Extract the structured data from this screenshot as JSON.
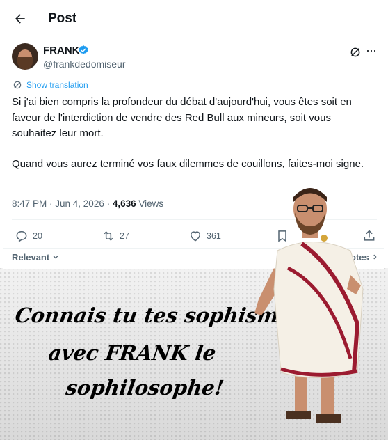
{
  "header": {
    "title": "Post"
  },
  "post": {
    "author_name": "FRANK",
    "author_handle": "@frankdedomiseur",
    "show_translation": "Show translation",
    "paragraphs": [
      "Si j'ai bien compris la profondeur du débat d'aujourd'hui, vous êtes soit en faveur de l'interdiction de vendre des Red Bull aux mineurs, soit vous souhaitez leur mort.",
      "Quand vous aurez terminé vos faux dilemmes de couillons, faites-moi signe."
    ],
    "time": "8:47 PM · Jun 4, 2026 · ",
    "views_count": "4,636",
    "views_label": " Views"
  },
  "actions": {
    "replies": "20",
    "reposts": "27",
    "likes": "361"
  },
  "replies_bar": {
    "sort": "Relevant",
    "quotes": "otes"
  },
  "meme": {
    "line1": "Connais tu tes sophismes",
    "line2": "avec FRANK le",
    "line3": "sophilosophe!"
  },
  "colors": {
    "accent": "#1d9bf0",
    "muted": "#536471",
    "text": "#0f1419",
    "toga_stripe": "#9b1b30"
  },
  "icons": [
    "back-arrow-icon",
    "verified-badge-icon",
    "grok-icon",
    "more-icon",
    "translate-icon",
    "reply-icon",
    "repost-icon",
    "like-icon",
    "bookmark-icon",
    "share-icon",
    "chevron-down-icon",
    "chevron-right-icon"
  ]
}
